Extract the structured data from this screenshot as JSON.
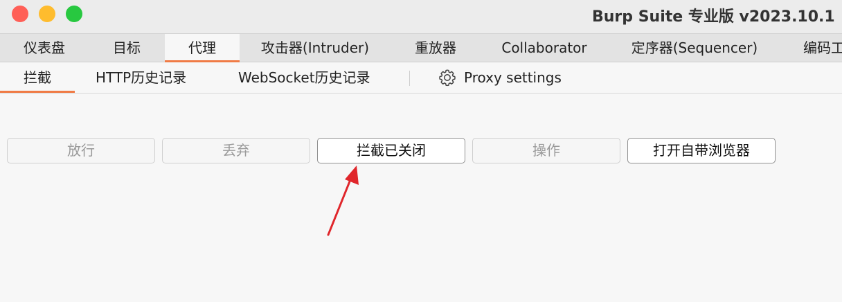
{
  "window": {
    "title": "Burp Suite 专业版  v2023.10.1"
  },
  "main_tabs": [
    {
      "label": "仪表盘"
    },
    {
      "label": "目标"
    },
    {
      "label": "代理",
      "active": true
    },
    {
      "label": "攻击器(Intruder)"
    },
    {
      "label": "重放器"
    },
    {
      "label": "Collaborator"
    },
    {
      "label": "定序器(Sequencer)"
    },
    {
      "label": "编码工"
    }
  ],
  "sub_tabs": [
    {
      "label": "拦截",
      "active": true
    },
    {
      "label": "HTTP历史记录"
    },
    {
      "label": "WebSocket历史记录"
    },
    {
      "label": "Proxy settings",
      "icon": "gear-icon"
    }
  ],
  "actions": [
    {
      "label": "放行",
      "enabled": false
    },
    {
      "label": "丢弃",
      "enabled": false
    },
    {
      "label": "拦截已关闭",
      "enabled": true
    },
    {
      "label": "操作",
      "enabled": false
    },
    {
      "label": "打开自带浏览器",
      "enabled": true
    }
  ],
  "colors": {
    "accent": "#f07b45",
    "annotation_arrow": "#e0262b"
  }
}
